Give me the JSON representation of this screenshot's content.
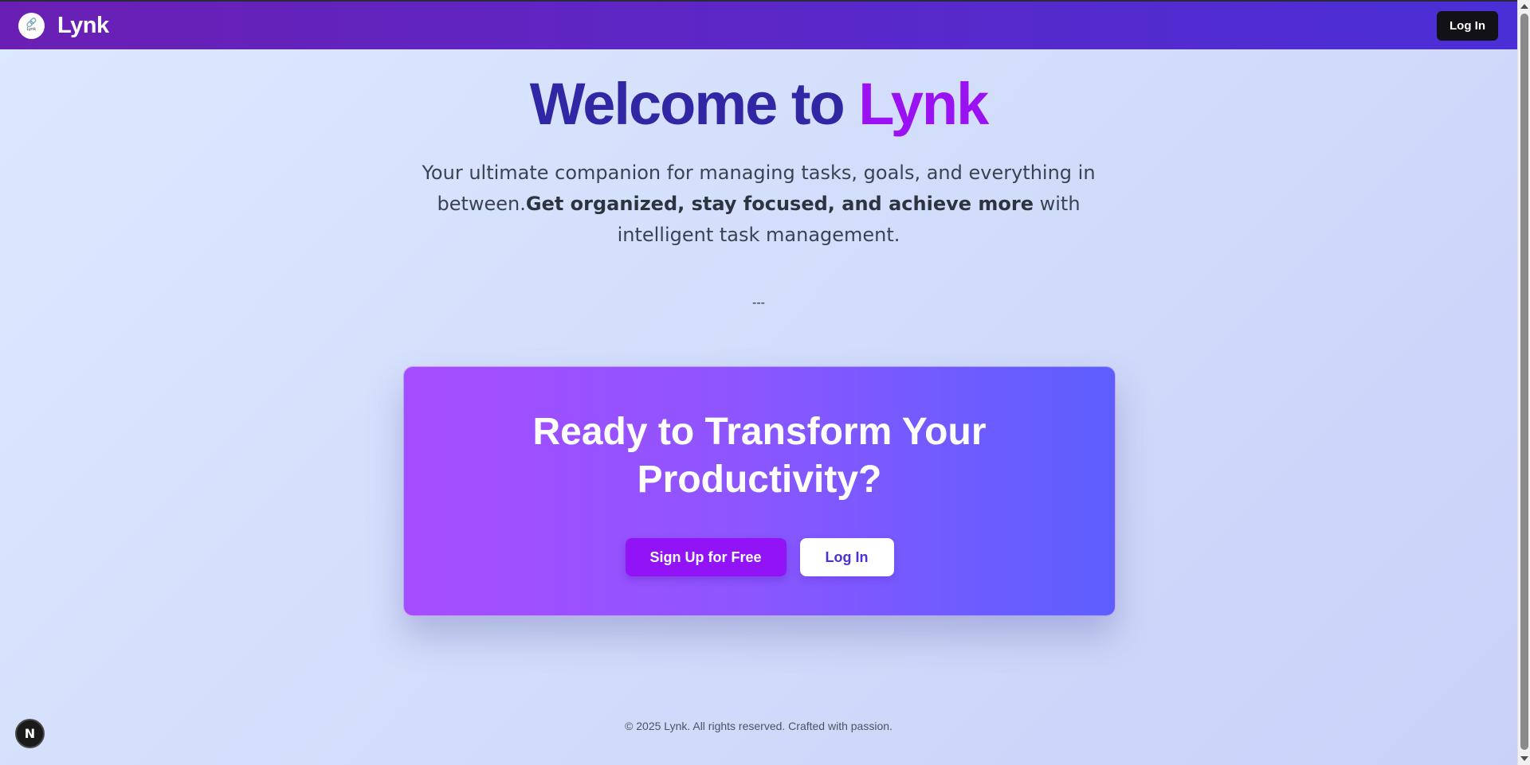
{
  "navbar": {
    "logo_icon": "link-icon",
    "logo_small_text": "Lynk",
    "brand": "Lynk",
    "login_label": "Log In"
  },
  "hero": {
    "title_prefix": "Welcome to ",
    "title_accent": "Lynk",
    "subtitle_part1": "Your ultimate companion for managing tasks, goals, and everything in between.",
    "subtitle_bold": "Get organized, stay focused, and achieve more",
    "subtitle_part2": " with intelligent task management.",
    "divider": "---"
  },
  "cta": {
    "title": "Ready to Transform Your Productivity?",
    "signup_label": "Sign Up for Free",
    "login_label": "Log In"
  },
  "footer": {
    "text": "© 2025 Lynk. All rights reserved. Crafted with passion."
  },
  "dev_badge": {
    "letter": "N"
  },
  "colors": {
    "navbar_start": "#6a1fb4",
    "navbar_end": "#4a2fd6",
    "title": "#3126a3",
    "accent": "#9a12f2",
    "cta_start": "#a64cff",
    "cta_end": "#5e5efe",
    "signup_button": "#9213f5"
  }
}
